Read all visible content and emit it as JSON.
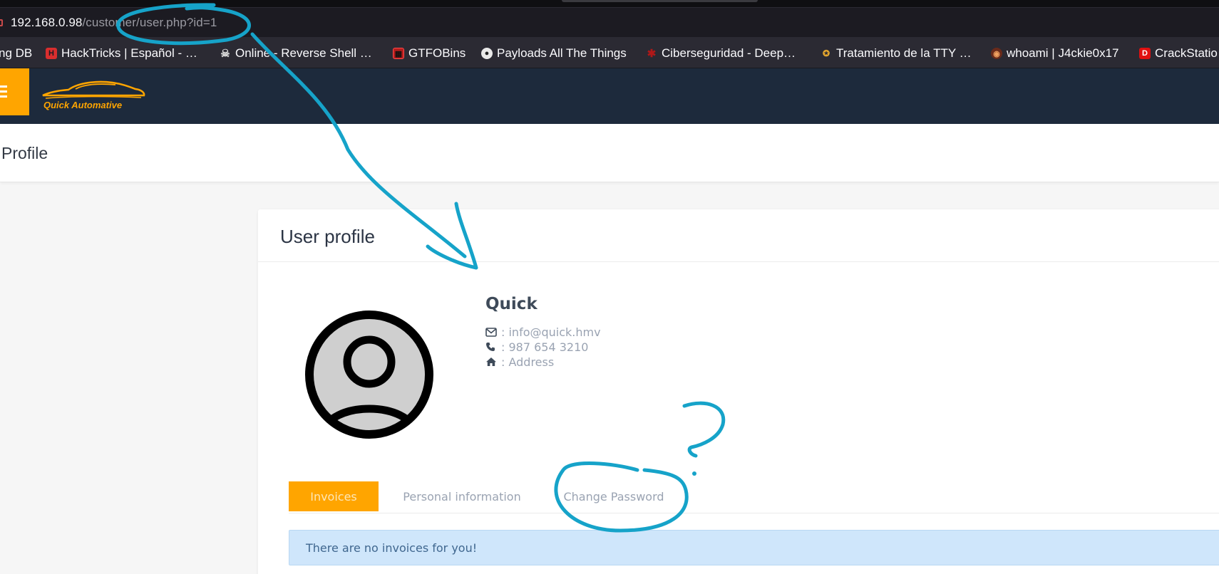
{
  "browser": {
    "url_host": "192.168.0.98",
    "url_path": "/customer/user.php?id=1",
    "bookmarks": [
      {
        "label": "ng DB",
        "icon": "none"
      },
      {
        "label": "HackTricks | Español - …",
        "icon": "hacktricks-icon"
      },
      {
        "label": "Online - Reverse Shell …",
        "icon": "skull-icon"
      },
      {
        "label": "GTFOBins",
        "icon": "gtfobins-icon"
      },
      {
        "label": "Payloads All The Things",
        "icon": "payloads-icon"
      },
      {
        "label": "Ciberseguridad - Deep…",
        "icon": "spider-icon"
      },
      {
        "label": "Tratamiento de la TTY …",
        "icon": "tty-icon"
      },
      {
        "label": "whoami | J4ckie0x17",
        "icon": "whoami-icon"
      },
      {
        "label": "CrackStatio",
        "icon": "crackstation-icon"
      }
    ]
  },
  "navbar": {
    "brand_name": "Quick Automative",
    "accent_color": "#ffa500",
    "background_color": "#1d2a3c"
  },
  "page": {
    "title": "Profile"
  },
  "profile": {
    "card_title": "User profile",
    "name": "Quick",
    "email_line": ": info@quick.hmv",
    "phone_line": ": 987 654 3210",
    "address_line": ": Address",
    "tabs": [
      {
        "label": "Invoices",
        "active": true
      },
      {
        "label": "Personal information",
        "active": false
      },
      {
        "label": "Change Password",
        "active": false
      }
    ],
    "alert_text": "There are no invoices for you!"
  },
  "annotations": {
    "color": "#16a3c9",
    "question_mark": "?"
  }
}
